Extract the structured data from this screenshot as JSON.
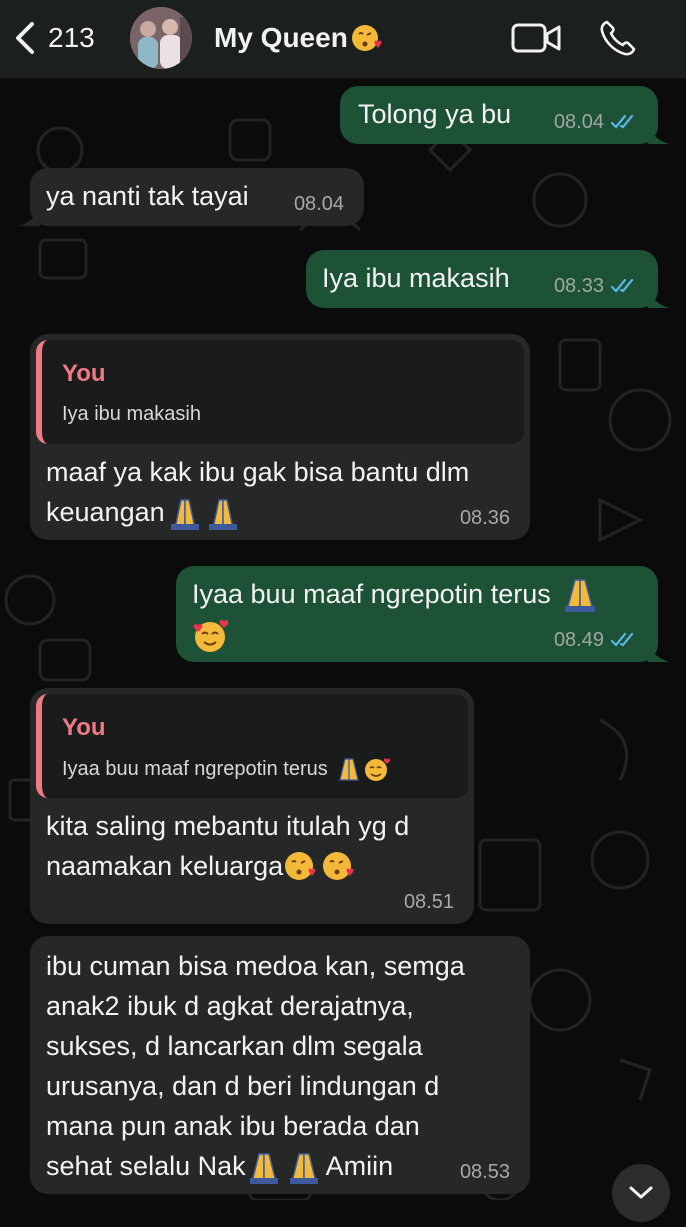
{
  "header": {
    "back_count": "213",
    "contact_name": "My Queen",
    "contact_emoji": "kissing-heart-emoji",
    "icons": [
      "back-chevron-icon",
      "video-call-icon",
      "phone-icon"
    ]
  },
  "colors": {
    "outgoing_bubble": "#1d5236",
    "incoming_bubble": "#262828",
    "quote_accent": "#f07a84",
    "read_ticks": "#5ab7e8",
    "header_bg": "#1b1f1d"
  },
  "messages": [
    {
      "dir": "out",
      "text": "Tolong ya bu",
      "time": "08.04",
      "read": true
    },
    {
      "dir": "in",
      "text": "ya nanti tak tayai",
      "time": "08.04"
    },
    {
      "dir": "out",
      "text": "Iya ibu makasih",
      "time": "08.33",
      "read": true
    },
    {
      "dir": "in",
      "quote_author": "You",
      "quote_text": "Iya ibu makasih",
      "text_line1": "maaf ya kak ibu gak bisa bantu dlm",
      "text_line2": "keuangan",
      "emojis": "pray pray",
      "time": "08.36"
    },
    {
      "dir": "out",
      "text": "Iyaa buu maaf ngrepotin terus",
      "emojis": "pray, smiling-hearts",
      "time": "08.49",
      "read": true
    },
    {
      "dir": "in",
      "quote_author": "You",
      "quote_text": "Iyaa buu maaf ngrepotin terus",
      "text_line1": "kita saling mebantu itulah yg d",
      "text_line2": "naamakan keluarga",
      "emojis": "kissing-heart kissing-heart",
      "time": "08.51"
    },
    {
      "dir": "in",
      "lines": [
        "ibu cuman bisa medoa kan, semga",
        "anak2 ibuk d agkat derajatnya,",
        "sukses, d lancarkan dlm  segala",
        "urusanya, dan d beri lindungan d",
        "mana pun anak ibu berada dan"
      ],
      "last_line_start": "sehat selalu Nak",
      "last_line_end": "Amiin",
      "time": "08.53"
    }
  ]
}
